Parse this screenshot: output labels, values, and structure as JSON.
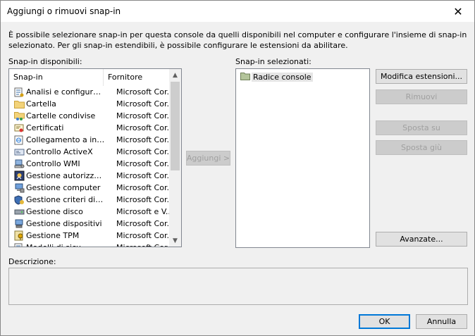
{
  "window": {
    "title": "Aggiungi o rimuovi snap-in",
    "close_glyph": "✕"
  },
  "intro": "È possibile selezionare snap-in per questa console da quelli disponibili nel computer e configurare l'insieme di snap-in selezionato. Per gli snap-in estendibili, è possibile configurare le estensioni da abilitare.",
  "available": {
    "label": "Snap-in disponibili:",
    "columns": [
      "Snap-in",
      "Fornitore"
    ],
    "rows": [
      {
        "name": "Analisi e configurazi...",
        "vendor": "Microsoft Cor...",
        "icon": "security-config-icon"
      },
      {
        "name": "Cartella",
        "vendor": "Microsoft Cor...",
        "icon": "folder-icon"
      },
      {
        "name": "Cartelle condivise",
        "vendor": "Microsoft Cor...",
        "icon": "shared-folders-icon"
      },
      {
        "name": "Certificati",
        "vendor": "Microsoft Cor...",
        "icon": "certificates-icon"
      },
      {
        "name": "Collegamento a indir...",
        "vendor": "Microsoft Cor...",
        "icon": "web-link-icon"
      },
      {
        "name": "Controllo ActiveX",
        "vendor": "Microsoft Cor...",
        "icon": "activex-icon"
      },
      {
        "name": "Controllo WMI",
        "vendor": "Microsoft Cor...",
        "icon": "wmi-icon"
      },
      {
        "name": "Gestione autorizzazioni",
        "vendor": "Microsoft Cor...",
        "icon": "authorization-icon"
      },
      {
        "name": "Gestione computer",
        "vendor": "Microsoft Cor...",
        "icon": "computer-management-icon"
      },
      {
        "name": "Gestione criteri di sic...",
        "vendor": "Microsoft Cor...",
        "icon": "ip-security-icon"
      },
      {
        "name": "Gestione disco",
        "vendor": "Microsoft e V...",
        "icon": "disk-icon"
      },
      {
        "name": "Gestione dispositivi",
        "vendor": "Microsoft Cor...",
        "icon": "device-manager-icon"
      },
      {
        "name": "Gestione TPM",
        "vendor": "Microsoft Cor...",
        "icon": "tpm-icon"
      },
      {
        "name": "Modelli di sicu...",
        "vendor": "Microsoft Cor...",
        "icon": "security-templates-icon"
      }
    ]
  },
  "add_button": "Aggiungi >",
  "selected": {
    "label": "Snap-in selezionati:",
    "items": [
      {
        "name": "Radice console",
        "icon": "folder-icon"
      }
    ]
  },
  "buttons": {
    "edit_extensions": "Modifica estensioni...",
    "remove": "Rimuovi",
    "move_up": "Sposta su",
    "move_down": "Sposta giù",
    "advanced": "Avanzate...",
    "ok": "OK",
    "cancel": "Annulla"
  },
  "description": {
    "label": "Descrizione:",
    "text": ""
  }
}
